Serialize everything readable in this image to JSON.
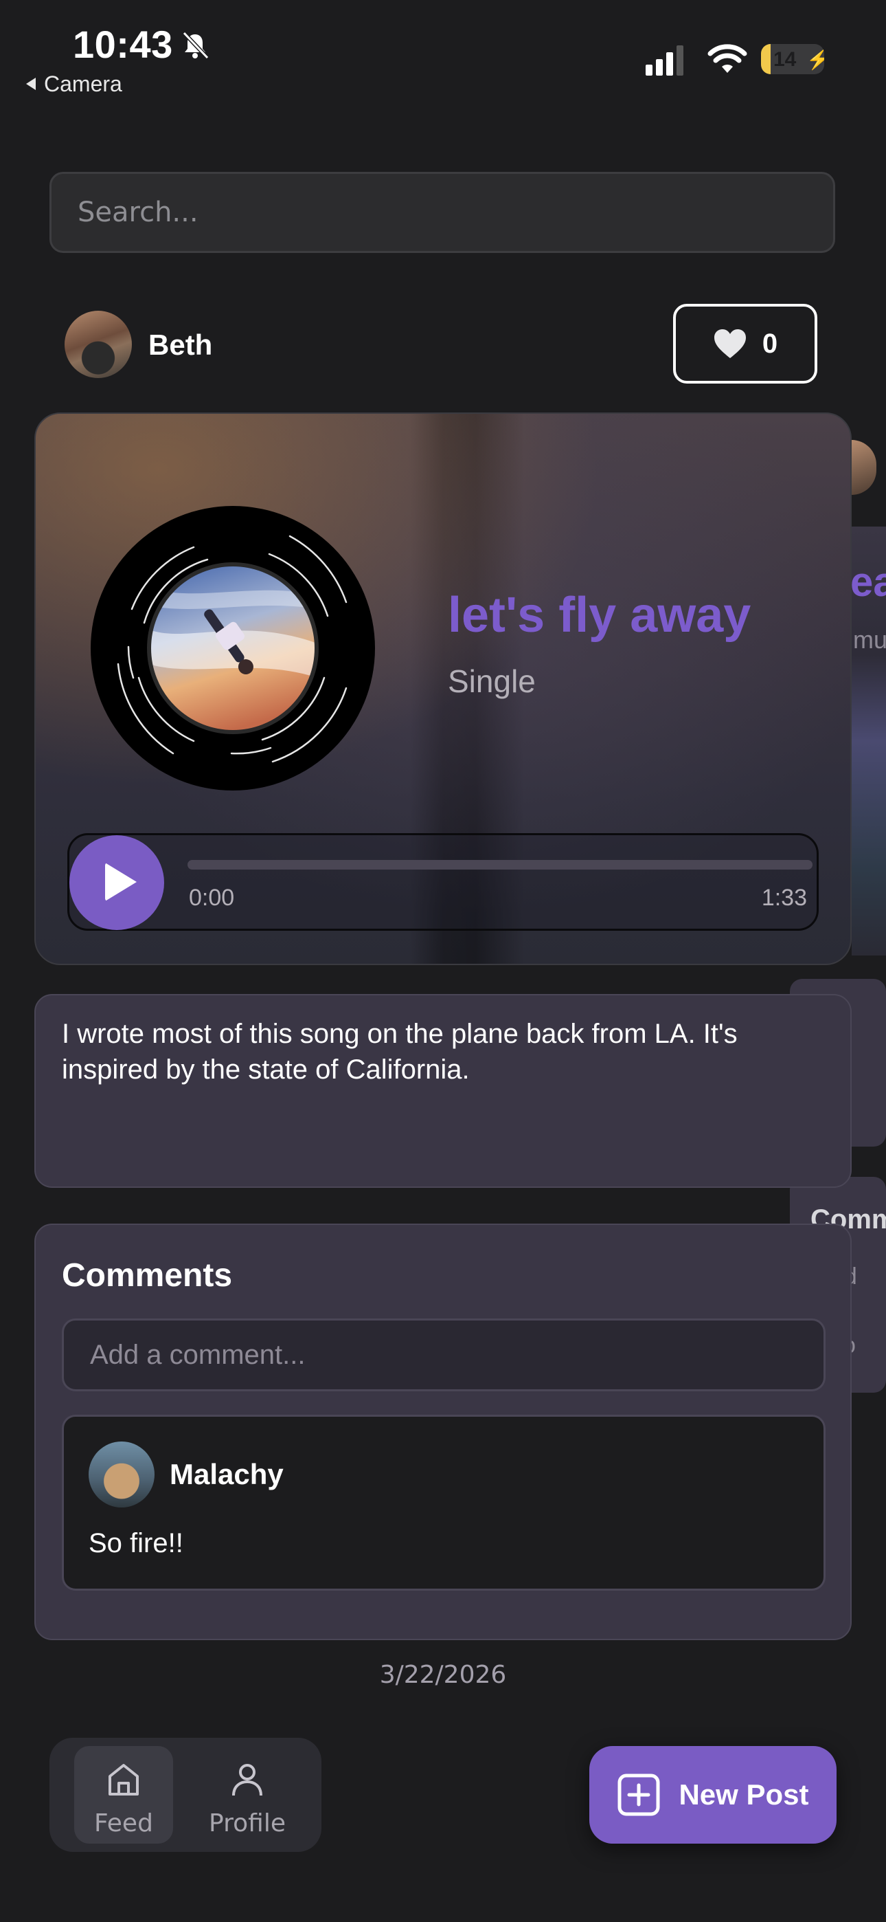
{
  "status_bar": {
    "time": "10:43",
    "back_app": "Camera",
    "battery": "14"
  },
  "search": {
    "placeholder": "Search..."
  },
  "post": {
    "author": "Beth",
    "likes": "0",
    "song": {
      "title": "let's fly away",
      "type": "Single",
      "current_time": "0:00",
      "duration": "1:33",
      "progress": 0
    },
    "description": "I wrote most of this song on the plane back from LA. It's inspired by the state of California.",
    "comments": {
      "title": "Comments",
      "input_placeholder": "Add a comment...",
      "items": [
        {
          "user": "Malachy",
          "text": "So fire!!"
        }
      ]
    },
    "date": "3/22/2026"
  },
  "peek_card": {
    "title_fragment": "ea",
    "subtitle_fragment": "mu",
    "comments_fragment": "Comm",
    "input_fragment": "dd",
    "comment_fragment": "co"
  },
  "nav": {
    "feed": "Feed",
    "profile": "Profile",
    "new_post": "New Post"
  },
  "colors": {
    "accent": "#7a5cc4",
    "background": "#1c1c1e",
    "card": "#3a3645"
  }
}
